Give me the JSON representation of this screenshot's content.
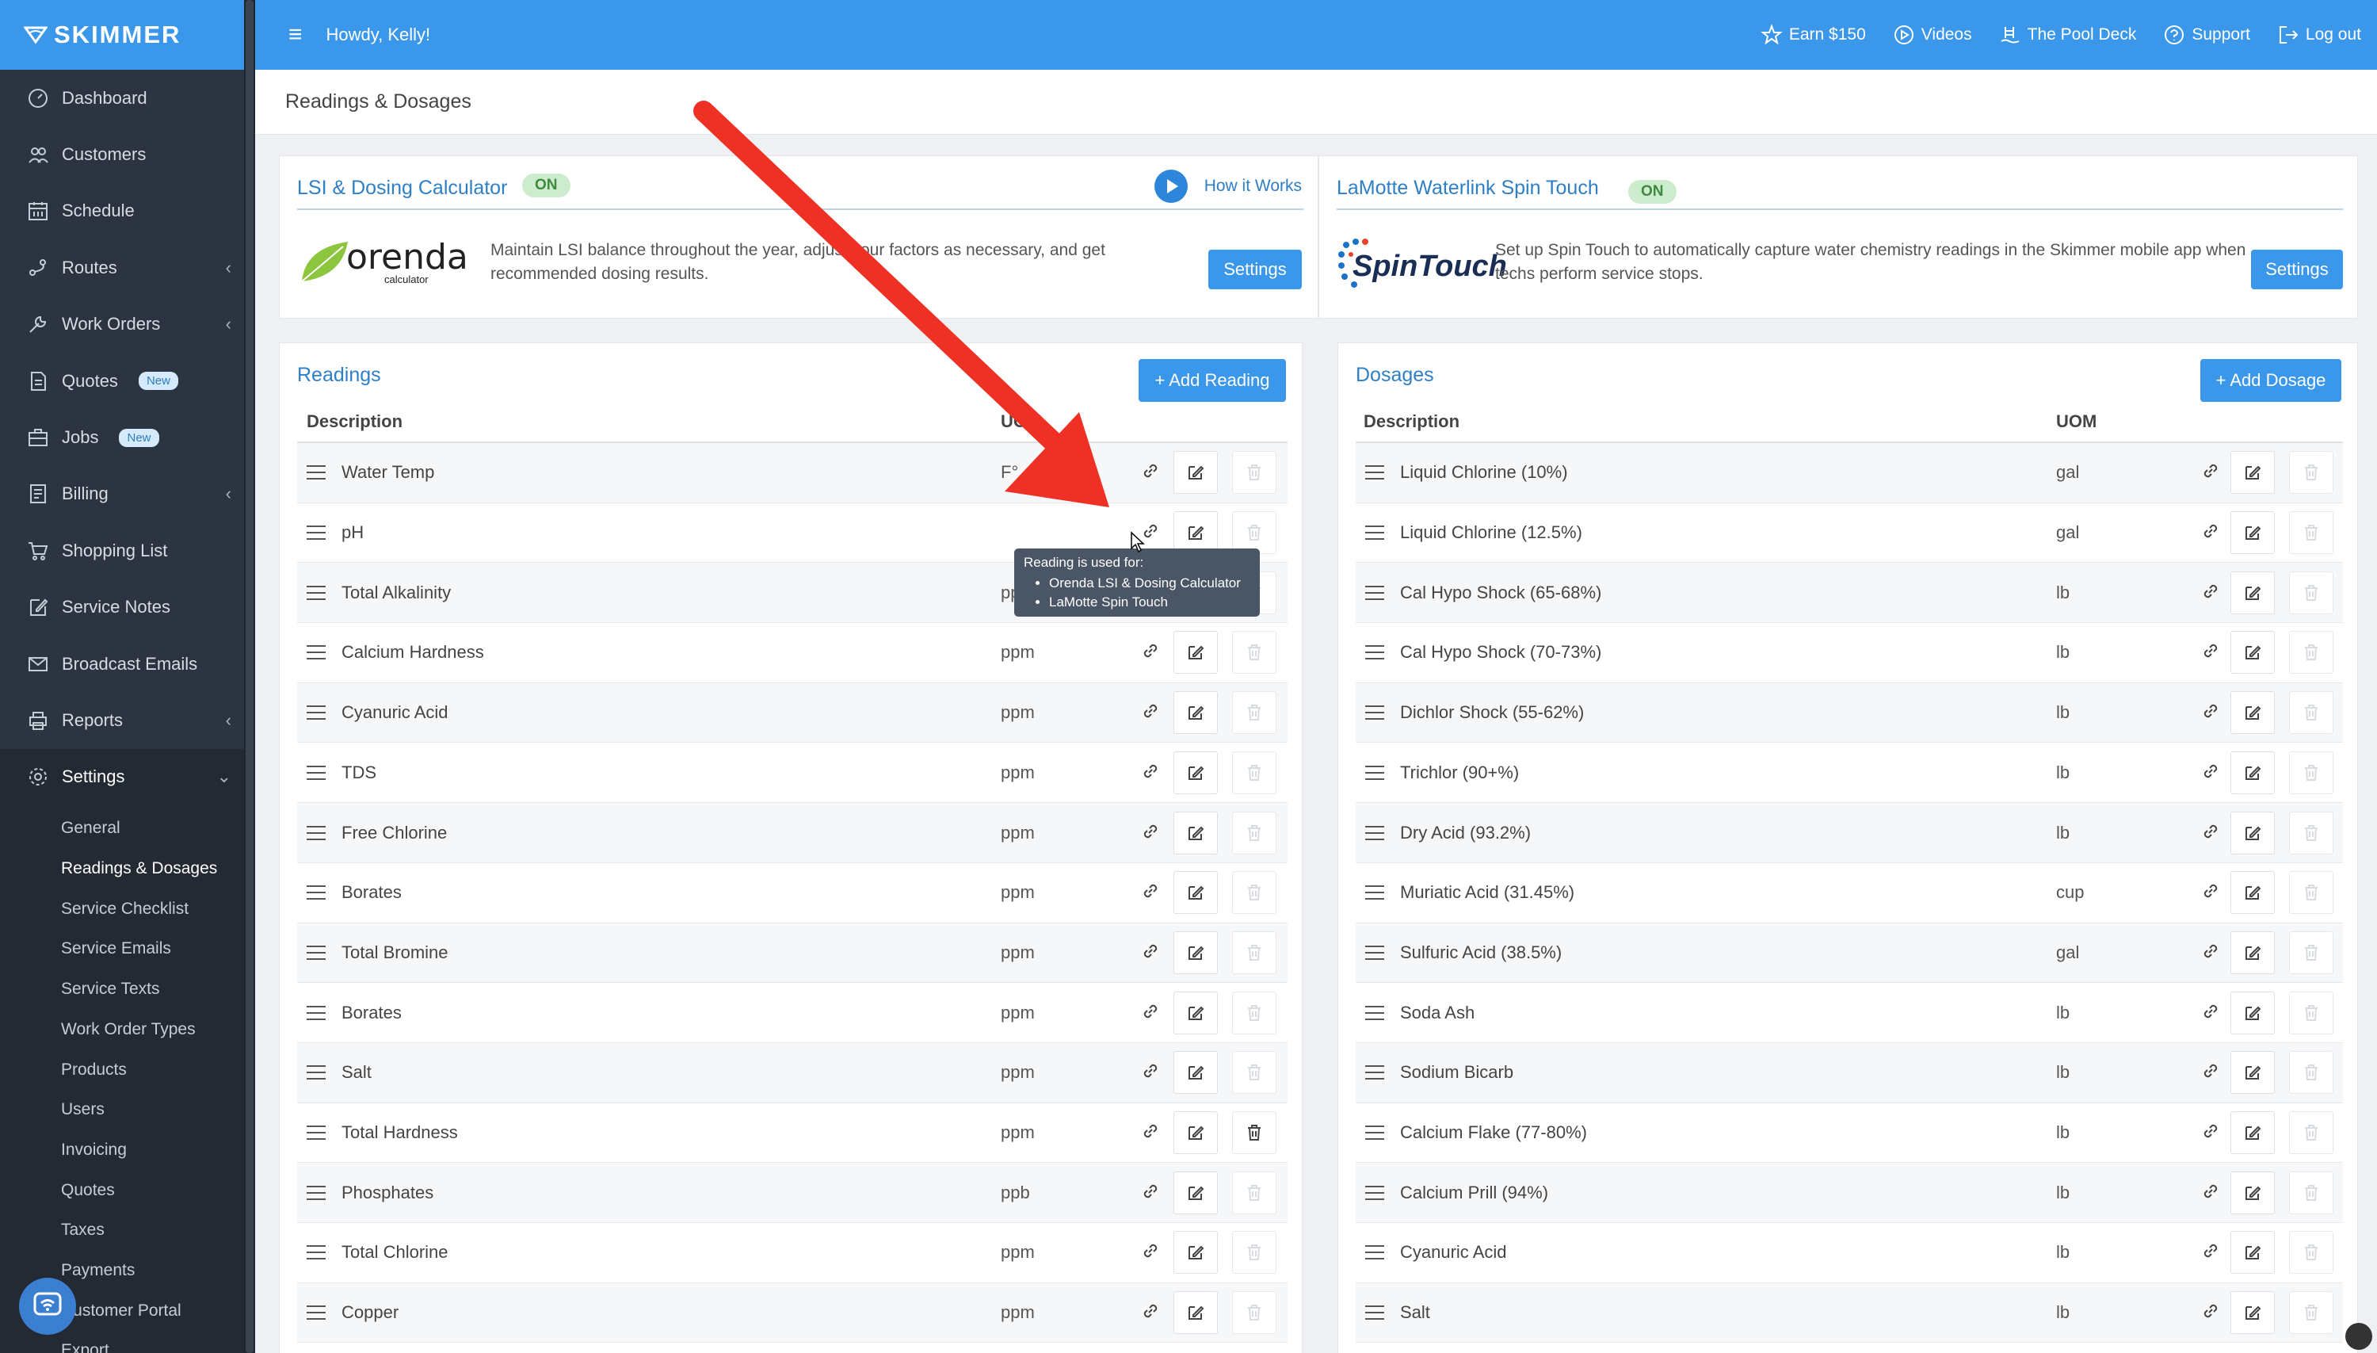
{
  "brand": "SKIMMER",
  "topbar": {
    "greeting": "Howdy, Kelly!",
    "links": [
      {
        "label": "Earn $150",
        "icon": "star-icon"
      },
      {
        "label": "Videos",
        "icon": "play-circle-icon"
      },
      {
        "label": "The Pool Deck",
        "icon": "pool-ladder-icon"
      },
      {
        "label": "Support",
        "icon": "help-circle-icon"
      },
      {
        "label": "Log out",
        "icon": "logout-icon"
      }
    ]
  },
  "sidebar": {
    "items": [
      {
        "label": "Dashboard",
        "icon": "dashboard-icon"
      },
      {
        "label": "Customers",
        "icon": "customers-icon"
      },
      {
        "label": "Schedule",
        "icon": "calendar-icon"
      },
      {
        "label": "Routes",
        "icon": "routes-icon",
        "chevron": "‹"
      },
      {
        "label": "Work Orders",
        "icon": "wrench-icon",
        "chevron": "‹"
      },
      {
        "label": "Quotes",
        "icon": "document-icon",
        "badge": "New"
      },
      {
        "label": "Jobs",
        "icon": "briefcase-icon",
        "badge": "New"
      },
      {
        "label": "Billing",
        "icon": "billing-icon",
        "chevron": "‹"
      },
      {
        "label": "Shopping List",
        "icon": "cart-icon"
      },
      {
        "label": "Service Notes",
        "icon": "note-edit-icon"
      },
      {
        "label": "Broadcast Emails",
        "icon": "mail-icon"
      },
      {
        "label": "Reports",
        "icon": "printer-icon",
        "chevron": "‹"
      },
      {
        "label": "Settings",
        "icon": "gear-icon",
        "chevron": "⌄"
      }
    ],
    "subitems": [
      "General",
      "Readings & Dosages",
      "Service Checklist",
      "Service Emails",
      "Service Texts",
      "Work Order Types",
      "Products",
      "Users",
      "Invoicing",
      "Quotes",
      "Taxes",
      "Payments",
      "Customer Portal",
      "Export"
    ]
  },
  "breadcrumb": "Readings & Dosages",
  "lsi_card": {
    "title": "LSI & Dosing Calculator",
    "badge": "ON",
    "how_it_works": "How it Works",
    "logo_text": "orenda",
    "logo_sub": "calculator",
    "text": "Maintain LSI balance throughout the year, adjust your factors as necessary, and get recommended dosing results.",
    "button": "Settings"
  },
  "lamotte_card": {
    "title": "LaMotte Waterlink Spin Touch",
    "badge": "ON",
    "logo_text": "SpinTouch",
    "text": "Set up Spin Touch to automatically capture water chemistry readings in the Skimmer mobile app when techs perform service stops.",
    "button": "Settings"
  },
  "readings": {
    "title": "Readings",
    "add_button": "+ Add Reading",
    "col_description": "Description",
    "col_uom": "UOM",
    "rows": [
      {
        "desc": "Water Temp",
        "uom": "F°"
      },
      {
        "desc": "pH",
        "uom": ""
      },
      {
        "desc": "Total Alkalinity",
        "uom": "ppm"
      },
      {
        "desc": "Calcium Hardness",
        "uom": "ppm"
      },
      {
        "desc": "Cyanuric Acid",
        "uom": "ppm"
      },
      {
        "desc": "TDS",
        "uom": "ppm"
      },
      {
        "desc": "Free Chlorine",
        "uom": "ppm"
      },
      {
        "desc": "Borates",
        "uom": "ppm"
      },
      {
        "desc": "Total Bromine",
        "uom": "ppm"
      },
      {
        "desc": "Borates",
        "uom": "ppm"
      },
      {
        "desc": "Salt",
        "uom": "ppm"
      },
      {
        "desc": "Total Hardness",
        "uom": "ppm"
      },
      {
        "desc": "Phosphates",
        "uom": "ppb"
      },
      {
        "desc": "Total Chlorine",
        "uom": "ppm"
      },
      {
        "desc": "Copper",
        "uom": "ppm"
      }
    ]
  },
  "dosages": {
    "title": "Dosages",
    "add_button": "+ Add Dosage",
    "col_description": "Description",
    "col_uom": "UOM",
    "rows": [
      {
        "desc": "Liquid Chlorine (10%)",
        "uom": "gal"
      },
      {
        "desc": "Liquid Chlorine (12.5%)",
        "uom": "gal"
      },
      {
        "desc": "Cal Hypo Shock (65-68%)",
        "uom": "lb"
      },
      {
        "desc": "Cal Hypo Shock (70-73%)",
        "uom": "lb"
      },
      {
        "desc": "Dichlor Shock (55-62%)",
        "uom": "lb"
      },
      {
        "desc": "Trichlor (90+%)",
        "uom": "lb"
      },
      {
        "desc": "Dry Acid (93.2%)",
        "uom": "lb"
      },
      {
        "desc": "Muriatic Acid (31.45%)",
        "uom": "cup"
      },
      {
        "desc": "Sulfuric Acid (38.5%)",
        "uom": "gal"
      },
      {
        "desc": "Soda Ash",
        "uom": "lb"
      },
      {
        "desc": "Sodium Bicarb",
        "uom": "lb"
      },
      {
        "desc": "Calcium Flake (77-80%)",
        "uom": "lb"
      },
      {
        "desc": "Calcium Prill (94%)",
        "uom": "lb"
      },
      {
        "desc": "Cyanuric Acid",
        "uom": "lb"
      },
      {
        "desc": "Salt",
        "uom": "lb"
      }
    ]
  },
  "tooltip": {
    "heading": "Reading is used for:",
    "items": [
      "Orenda LSI & Dosing Calculator",
      "LaMotte Spin Touch"
    ]
  },
  "colors": {
    "accent": "#3b97e9",
    "sidebar": "#2b3440",
    "annotation_arrow": "#ee3124"
  }
}
